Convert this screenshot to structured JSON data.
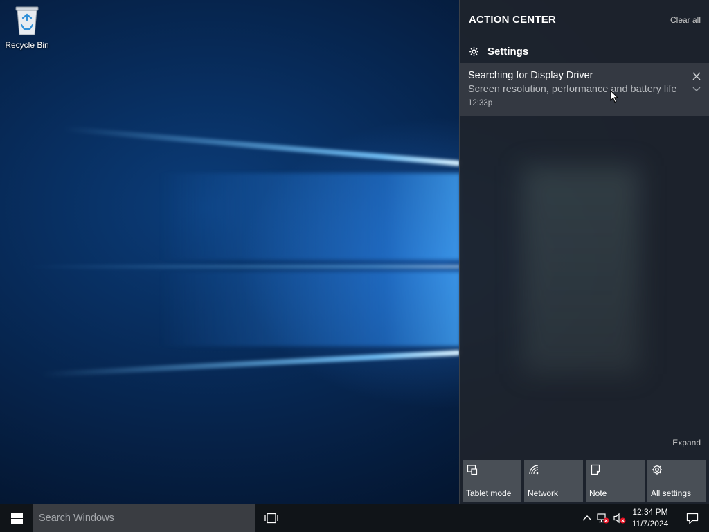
{
  "desktop": {
    "icons": [
      {
        "label": "Recycle Bin",
        "icon": "recycle-bin-icon"
      }
    ]
  },
  "action_center": {
    "title": "ACTION CENTER",
    "clear_all": "Clear all",
    "group": {
      "icon": "gear-icon",
      "label": "Settings"
    },
    "notification": {
      "title": "Searching for Display Driver",
      "body": "Screen resolution, performance and battery life",
      "time": "12:33p"
    },
    "expand_label": "Expand",
    "quick_actions": [
      {
        "label": "Tablet mode",
        "icon": "tablet-mode-icon"
      },
      {
        "label": "Network",
        "icon": "network-icon"
      },
      {
        "label": "Note",
        "icon": "note-icon"
      },
      {
        "label": "All settings",
        "icon": "gear-icon"
      }
    ]
  },
  "taskbar": {
    "search_placeholder": "Search Windows",
    "clock": {
      "time": "12:34 PM",
      "date": "11/7/2024"
    },
    "tray_icons": [
      "chevron-up-icon",
      "network-disconnected-icon",
      "volume-muted-icon"
    ]
  },
  "colors": {
    "accent": "#0078d7",
    "action_center_bg": "#1e242c",
    "tile_bg": "#494f56",
    "taskbar_bg": "#101418"
  }
}
